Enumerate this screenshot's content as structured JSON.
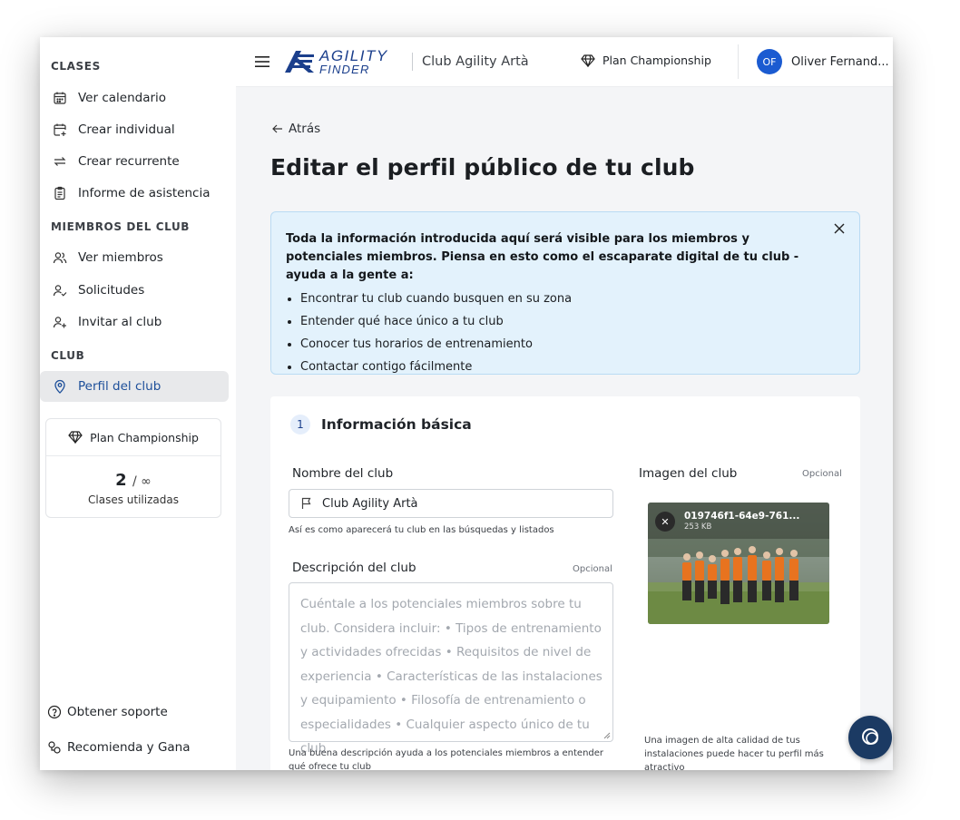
{
  "sidebar": {
    "sections": {
      "clases": "CLASES",
      "miembros": "MIEMBROS DEL CLUB",
      "club": "CLUB"
    },
    "items": [
      {
        "label": "Ver calendario",
        "icon": "calendar-icon"
      },
      {
        "label": "Crear individual",
        "icon": "calendar-plus-icon"
      },
      {
        "label": "Crear recurrente",
        "icon": "repeat-icon"
      },
      {
        "label": "Informe de asistencia",
        "icon": "clipboard-icon"
      },
      {
        "label": "Ver miembros",
        "icon": "users-icon"
      },
      {
        "label": "Solicitudes",
        "icon": "user-check-icon"
      },
      {
        "label": "Invitar al club",
        "icon": "user-plus-icon"
      },
      {
        "label": "Perfil del club",
        "icon": "location-pin-icon",
        "active": true
      }
    ],
    "plan": {
      "name": "Plan Championship",
      "used": "2",
      "limit": "/ ∞",
      "label": "Clases utilizadas"
    },
    "support": "Obtener soporte",
    "refer": "Recomienda y Gana"
  },
  "header": {
    "logo_line1": "AGILITY",
    "logo_line2": "FINDER",
    "club_name": "Club Agility Artà",
    "plan": "Plan Championship",
    "avatar_initials": "OF",
    "user_name": "Oliver Fernand..."
  },
  "main": {
    "back": "Atrás",
    "title": "Editar el perfil público de tu club",
    "info": {
      "intro": "Toda la información introducida aquí será visible para los miembros y potenciales miembros. Piensa en esto como el escaparate digital de tu club - ayuda a la gente a:",
      "bullets": [
        "Encontrar tu club cuando busquen en su zona",
        "Entender qué hace único a tu club",
        "Conocer tus horarios de entrenamiento",
        "Contactar contigo fácilmente"
      ]
    },
    "section": {
      "number": "1",
      "title": "Información básica",
      "name_label": "Nombre del club",
      "name_value": "Club Agility Artà",
      "name_hint": "Así es como aparecerá tu club en las búsquedas y listados",
      "desc_label": "Descripción del club",
      "desc_optional": "Opcional",
      "desc_placeholder": "Cuéntale a los potenciales miembros sobre tu club. Considera incluir: • Tipos de entrenamiento y actividades ofrecidas • Requisitos de nivel de experiencia • Características de las instalaciones y equipamiento • Filosofía de entrenamiento o especialidades • Cualquier aspecto único de tu club",
      "desc_hint": "Una buena descripción ayuda a los potenciales miembros a entender qué ofrece tu club",
      "image_label": "Imagen del club",
      "image_optional": "Opcional",
      "image_name": "019746f1-64e9-761...",
      "image_size": "253 KB",
      "image_hint": "Una imagen de alta calidad de tus instalaciones puede hacer tu perfil más atractivo"
    }
  },
  "colors": {
    "brand": "#1b3f8c",
    "avatar": "#1b5bd1",
    "info_bg": "#e3f2fc",
    "chat_fab": "#1b3a63"
  }
}
